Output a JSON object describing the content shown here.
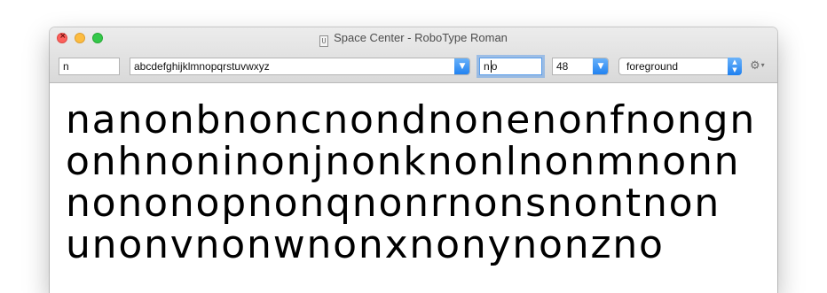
{
  "window": {
    "title": "Space Center - RoboType Roman",
    "doc_icon_letter": "U"
  },
  "toolbar": {
    "control_field": "n",
    "glyph_string": "abcdefghijklmnopqrstuvwxyz",
    "suffix_field_before_caret": "n",
    "suffix_field_after_caret": "o",
    "point_size": "48",
    "layer": "foreground"
  },
  "icons": {
    "close": "close-icon",
    "combo_arrow": "chevron-down-icon",
    "popup_arrows": "up-down-arrows-icon",
    "settings": "gear-icon"
  },
  "preview": {
    "lines": [
      "nanonbnoncnondnonenonfnongn",
      "onhnoninonjnonknonlnonmnonn",
      "nononopnonqnonrnonsnontnon",
      "unonvnonwnonxnonynonzno"
    ]
  },
  "colors": {
    "accent": "#1e80f0",
    "traffic_close": "#fc605c",
    "traffic_minimize": "#fdbc40",
    "traffic_maximize": "#34c84a"
  }
}
